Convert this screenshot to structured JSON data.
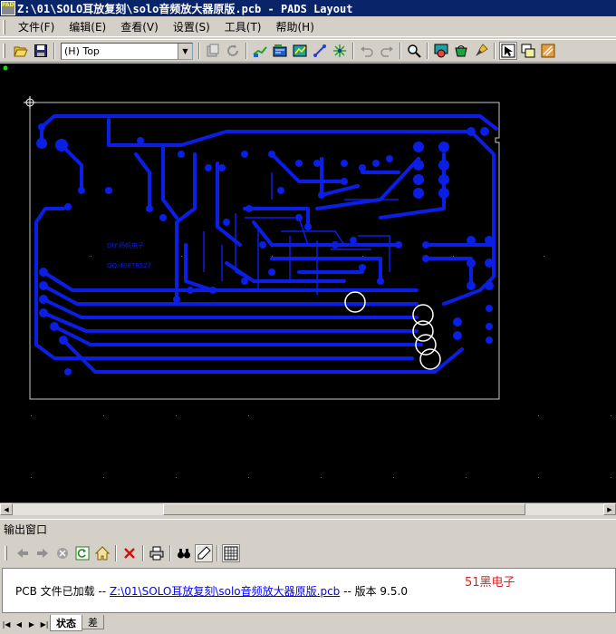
{
  "window": {
    "app_icon_text": "PADS",
    "title": "Z:\\01\\SOLO耳放复刻\\solo音频放大器原版.pcb - PADS Layout"
  },
  "menu": [
    "文件(F)",
    "编辑(E)",
    "查看(V)",
    "设置(S)",
    "工具(T)",
    "帮助(H)"
  ],
  "toolbar": {
    "layer_value": "(H) Top",
    "buttons": [
      {
        "name": "open-icon"
      },
      {
        "name": "save-icon"
      }
    ],
    "right_buttons": [
      {
        "name": "properties-icon"
      },
      {
        "name": "refresh-icon"
      },
      {
        "name": "route-icon"
      },
      {
        "name": "design-icon"
      },
      {
        "name": "drafting-icon"
      },
      {
        "name": "wire-icon"
      },
      {
        "name": "ecolayer-icon"
      },
      {
        "name": "undo-icon"
      },
      {
        "name": "redo-icon"
      },
      {
        "name": "zoom-icon"
      },
      {
        "name": "verify-icon"
      },
      {
        "name": "pour-icon"
      },
      {
        "name": "brush-icon"
      },
      {
        "name": "select-mode-icon"
      },
      {
        "name": "window-icon"
      },
      {
        "name": "pads-icon"
      }
    ]
  },
  "pcb": {
    "labels": [
      "QQ:46878527",
      "DIY:杨帆电子"
    ]
  },
  "output": {
    "window_title": "输出窗口",
    "message_prefix": "PCB 文件已加载  -- ",
    "message_link": "Z:\\01\\SOLO耳放复刻\\solo音频放大器原版.pcb",
    "message_suffix": "  -- 版本  9.5.0",
    "watermark": "51黑电子"
  },
  "tabs": [
    "状态",
    "差"
  ],
  "colors": {
    "trace": "#0a1ee6",
    "board_outline": "#c8c8c8",
    "background": "#000000",
    "titlebar": "#0a246a"
  }
}
